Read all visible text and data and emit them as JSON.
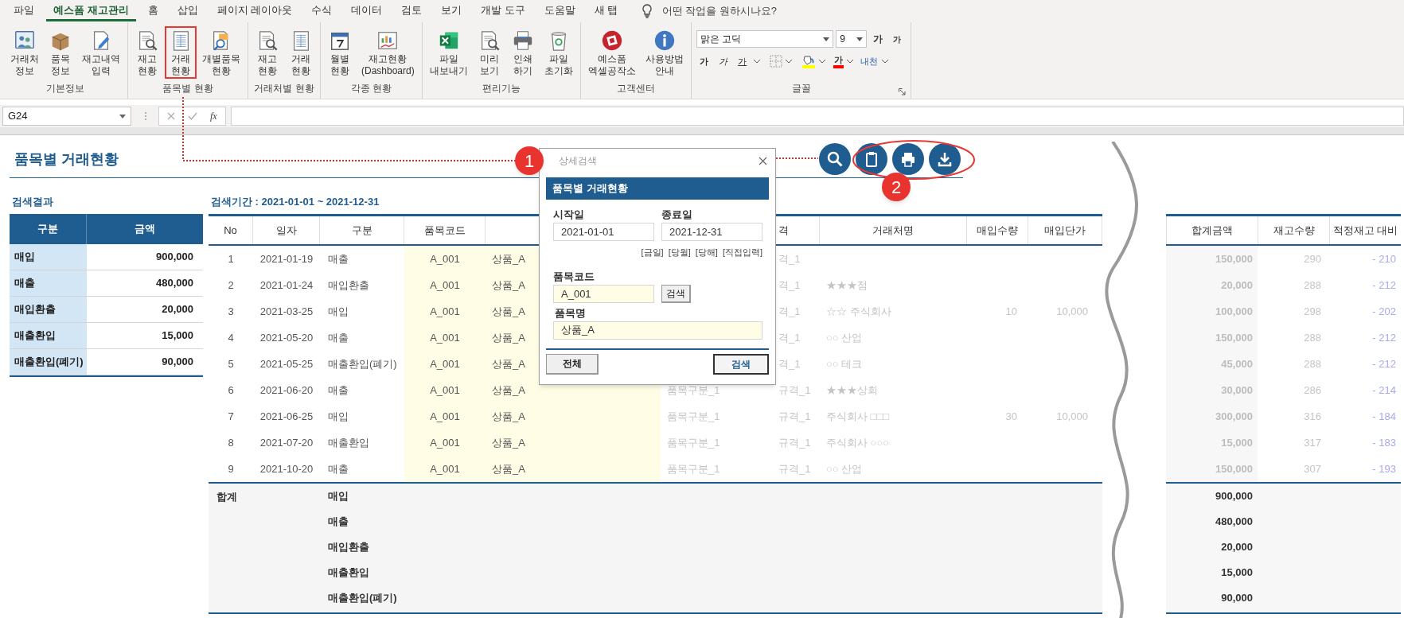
{
  "menu_tabs": [
    {
      "label": "파일",
      "selected": false
    },
    {
      "label": "예스폼 재고관리",
      "selected": true
    },
    {
      "label": "홈",
      "selected": false
    },
    {
      "label": "삽입",
      "selected": false
    },
    {
      "label": "페이지 레이아웃",
      "selected": false
    },
    {
      "label": "수식",
      "selected": false
    },
    {
      "label": "데이터",
      "selected": false
    },
    {
      "label": "검토",
      "selected": false
    },
    {
      "label": "보기",
      "selected": false
    },
    {
      "label": "개발 도구",
      "selected": false
    },
    {
      "label": "도움말",
      "selected": false
    },
    {
      "label": "새 탭",
      "selected": false
    }
  ],
  "tell_me": "어떤 작업을 원하시나요?",
  "ribbon_groups": [
    {
      "label": "기본정보",
      "buttons": [
        {
          "label": "거래처\n정보",
          "highlighted": false
        },
        {
          "label": "품목\n정보",
          "highlighted": false
        },
        {
          "label": "재고내역\n입력",
          "highlighted": false
        }
      ]
    },
    {
      "label": "품목별 현황",
      "buttons": [
        {
          "label": "재고\n현황",
          "highlighted": false
        },
        {
          "label": "거래\n현황",
          "highlighted": true
        },
        {
          "label": "개별품목\n현황",
          "highlighted": false
        }
      ]
    },
    {
      "label": "거래처별 현황",
      "buttons": [
        {
          "label": "재고\n현황",
          "highlighted": false
        },
        {
          "label": "거래\n현황",
          "highlighted": false
        }
      ]
    },
    {
      "label": "각종 현황",
      "buttons": [
        {
          "label": "월별\n현황",
          "highlighted": false
        },
        {
          "label": "재고현황\n(Dashboard)",
          "highlighted": false
        }
      ]
    },
    {
      "label": "편리기능",
      "buttons": [
        {
          "label": "파일\n내보내기",
          "highlighted": false
        },
        {
          "label": "미리\n보기",
          "highlighted": false
        },
        {
          "label": "인쇄\n하기",
          "highlighted": false
        },
        {
          "label": "파일\n초기화",
          "highlighted": false
        }
      ]
    },
    {
      "label": "고객센터",
      "buttons": [
        {
          "label": "예스폼\n엑셀공작소",
          "highlighted": false
        },
        {
          "label": "사용방법\n안내",
          "highlighted": false
        }
      ]
    }
  ],
  "font_group": {
    "label": "글꼴",
    "font_name": "맑은 고딕",
    "font_size": "9",
    "grow": "가",
    "shrink": "가",
    "bold": "가",
    "italic": "가",
    "underline": "가",
    "font_color": "가",
    "phonetic": "내천"
  },
  "formula_bar": {
    "name_box": "G24",
    "fx": "fx"
  },
  "sheet": {
    "title": "품목별 거래현황",
    "summary": {
      "heading": "검색결과",
      "columns": [
        "구분",
        "금액"
      ],
      "rows": [
        {
          "label": "매입",
          "amount": "900,000"
        },
        {
          "label": "매출",
          "amount": "480,000"
        },
        {
          "label": "매입환출",
          "amount": "20,000"
        },
        {
          "label": "매출환입",
          "amount": "15,000"
        },
        {
          "label": "매출환입(폐기)",
          "amount": "90,000"
        }
      ]
    },
    "period": "검색기간 : 2021-01-01 ~ 2021-12-31",
    "columns": {
      "no": "No",
      "date": "일자",
      "type": "구분",
      "code": "품목코드",
      "spec": "격",
      "vendor": "거래처명",
      "qty": "매입수량",
      "price": "매입단가",
      "total": "합계금액",
      "stock": "재고수량",
      "diff": "적정재고 대비"
    },
    "rows": [
      {
        "no": "1",
        "date": "2021-01-19",
        "type": "매출",
        "code": "A_001",
        "name": "상품_A",
        "spec": "격_1",
        "total": "150,000",
        "stock": "290",
        "diff": "- 210"
      },
      {
        "no": "2",
        "date": "2021-01-24",
        "type": "매입환출",
        "code": "A_001",
        "name": "상품_A",
        "spec": "격_1",
        "vendor": "★★★점",
        "total": "20,000",
        "stock": "288",
        "diff": "- 212"
      },
      {
        "no": "3",
        "date": "2021-03-25",
        "type": "매입",
        "code": "A_001",
        "name": "상품_A",
        "spec": "격_1",
        "vendor": "☆☆ 주식회사",
        "qty": "10",
        "price": "10,000",
        "total": "100,000",
        "stock": "298",
        "diff": "- 202"
      },
      {
        "no": "4",
        "date": "2021-05-20",
        "type": "매출",
        "code": "A_001",
        "name": "상품_A",
        "spec": "격_1",
        "vendor": "○○ 산업",
        "total": "150,000",
        "stock": "288",
        "diff": "- 212"
      },
      {
        "no": "5",
        "date": "2021-05-25",
        "type": "매출환입(폐기)",
        "code": "A_001",
        "name": "상품_A",
        "spec": "격_1",
        "vendor": "○○ 테크",
        "total": "45,000",
        "stock": "288",
        "diff": "- 212"
      },
      {
        "no": "6",
        "date": "2021-06-20",
        "type": "매출",
        "code": "A_001",
        "name": "상품_A",
        "category": "품목구분_1",
        "spec": "규격_1",
        "vendor": "★★★상회",
        "total": "30,000",
        "stock": "286",
        "diff": "- 214"
      },
      {
        "no": "7",
        "date": "2021-06-25",
        "type": "매입",
        "code": "A_001",
        "name": "상품_A",
        "category": "품목구분_1",
        "spec": "규격_1",
        "vendor": "주식회사 □□□",
        "qty": "30",
        "price": "10,000",
        "total": "300,000",
        "stock": "316",
        "diff": "- 184"
      },
      {
        "no": "8",
        "date": "2021-07-20",
        "type": "매출환입",
        "code": "A_001",
        "name": "상품_A",
        "category": "품목구분_1",
        "spec": "규격_1",
        "vendor": "주식회사 ○○○",
        "total": "15,000",
        "stock": "317",
        "diff": "- 183"
      },
      {
        "no": "9",
        "date": "2021-10-20",
        "type": "매출",
        "code": "A_001",
        "name": "상품_A",
        "category": "품목구분_1",
        "spec": "규격_1",
        "vendor": "○○ 산업",
        "total": "150,000",
        "stock": "307",
        "diff": "- 193"
      }
    ],
    "totals": {
      "label": "합계",
      "rows": [
        {
          "type": "매입",
          "amount": "900,000"
        },
        {
          "type": "매출",
          "amount": "480,000"
        },
        {
          "type": "매입환출",
          "amount": "20,000"
        },
        {
          "type": "매출환입",
          "amount": "15,000"
        },
        {
          "type": "매출환입(폐기)",
          "amount": "90,000"
        }
      ]
    }
  },
  "dialog": {
    "title": "상세검색",
    "header": "품목별 거래현황",
    "start_label": "시작일",
    "start_value": "2021-01-01",
    "end_label": "종료일",
    "end_value": "2021-12-31",
    "shortcuts": [
      "[금일]",
      "[당월]",
      "[당해]",
      "[직접입력]"
    ],
    "code_label": "품목코드",
    "code_value": "A_001",
    "code_button": "검색",
    "name_label": "품목명",
    "name_value": "상품_A",
    "all_button": "전체",
    "search_button": "검색"
  },
  "callouts": [
    "1",
    "2"
  ]
}
